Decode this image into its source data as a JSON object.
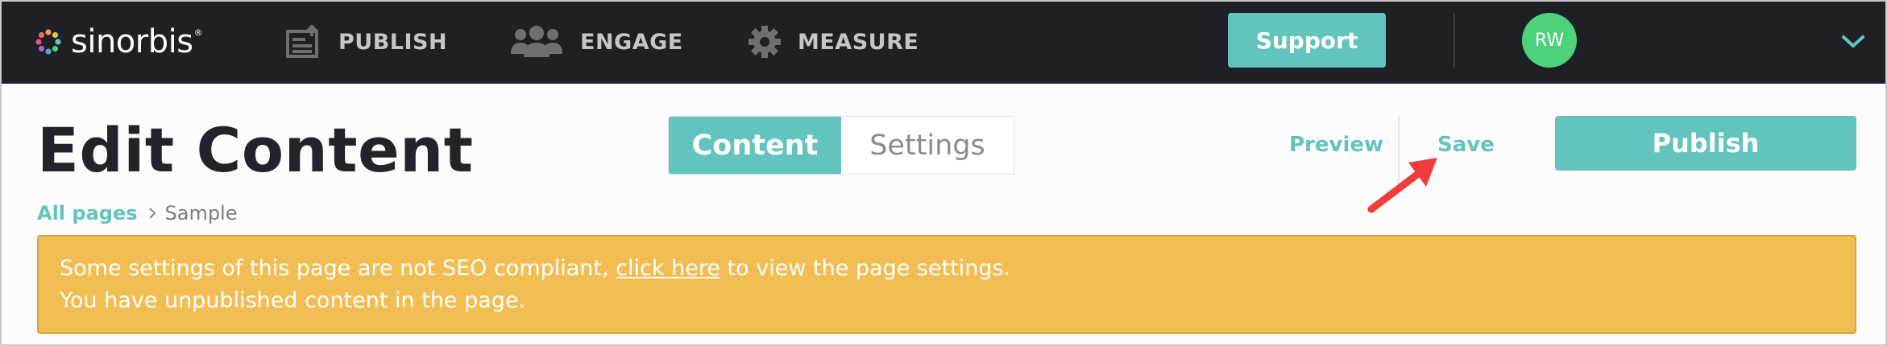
{
  "app": {
    "brand": "sinorbis",
    "brand_mark": "®"
  },
  "nav": {
    "items": [
      {
        "label": "PUBLISH",
        "icon": "publish-icon"
      },
      {
        "label": "ENGAGE",
        "icon": "people-icon"
      },
      {
        "label": "MEASURE",
        "icon": "gear-icon"
      }
    ],
    "support_label": "Support",
    "avatar_initials": "RW"
  },
  "page": {
    "title": "Edit Content",
    "tabs": [
      {
        "label": "Content",
        "active": true
      },
      {
        "label": "Settings",
        "active": false
      }
    ],
    "preview_label": "Preview",
    "save_label": "Save",
    "publish_label": "Publish"
  },
  "breadcrumb": {
    "root": "All pages",
    "current": "Sample"
  },
  "alert": {
    "line1_before": "Some settings of this page are not SEO compliant, ",
    "line1_link": "click here",
    "line1_after": " to view the page settings.",
    "line2": "You have unpublished content in the page."
  },
  "colors": {
    "accent": "#63c4bd",
    "topbar": "#1f2025",
    "alert": "#f2bd53",
    "avatar": "#4bd27a",
    "annotation": "#ef3c3c"
  }
}
